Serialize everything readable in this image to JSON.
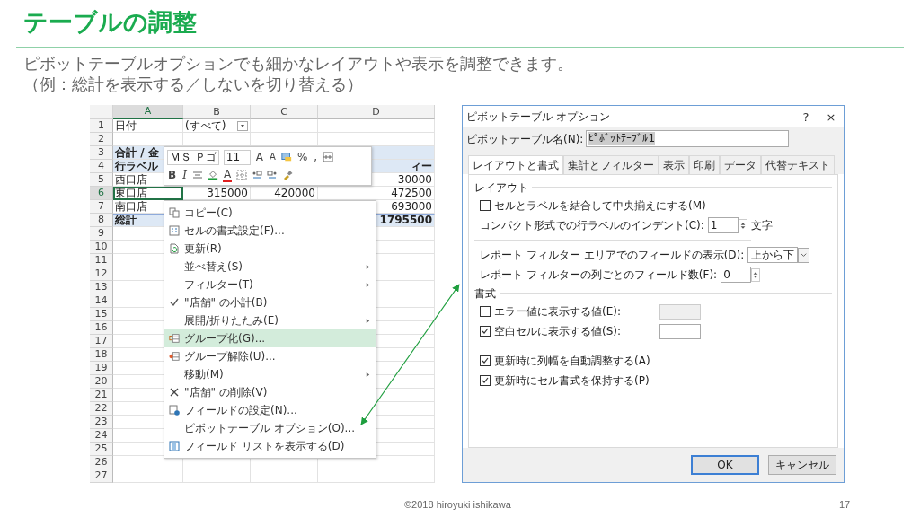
{
  "slide": {
    "title": "テーブルの調整",
    "lines": [
      "ピボットテーブルオプションでも細かなレイアウトや表示を調整できます。",
      "（例：総計を表示する／しないを切り替える）"
    ]
  },
  "sheet": {
    "columns": [
      {
        "label": "A",
        "selected": true
      },
      {
        "label": "B",
        "selected": false
      },
      {
        "label": "C",
        "selected": false
      },
      {
        "label": "D",
        "selected": false
      }
    ],
    "rows": [
      {
        "number": "1",
        "kind": "filter",
        "selected": false,
        "cells": {
          "A": "日付",
          "B": "(すべて)"
        }
      },
      {
        "number": "2",
        "kind": "empty",
        "selected": false,
        "cells": {}
      },
      {
        "number": "3",
        "kind": "header",
        "selected": false,
        "cells": {
          "A": "合計 / 金"
        }
      },
      {
        "number": "4",
        "kind": "header",
        "selected": false,
        "cells": {
          "A": "行ラベル",
          "D": "ィー"
        }
      },
      {
        "number": "5",
        "kind": "data",
        "selected": false,
        "cells": {
          "A": "西口店",
          "D": "30000"
        }
      },
      {
        "number": "6",
        "kind": "data",
        "selected": true,
        "cells": {
          "A": "東口店",
          "B": "315000",
          "C": "420000",
          "D": "472500"
        }
      },
      {
        "number": "7",
        "kind": "data",
        "selected": false,
        "cells": {
          "A": "南口店",
          "D": "693000"
        }
      },
      {
        "number": "8",
        "kind": "total",
        "selected": false,
        "cells": {
          "A": "総計",
          "D": "1795500"
        }
      },
      {
        "number": "9",
        "kind": "empty",
        "selected": false,
        "cells": {}
      },
      {
        "number": "10",
        "kind": "empty",
        "selected": false,
        "cells": {}
      },
      {
        "number": "11",
        "kind": "empty",
        "selected": false,
        "cells": {}
      },
      {
        "number": "12",
        "kind": "empty",
        "selected": false,
        "cells": {}
      },
      {
        "number": "13",
        "kind": "empty",
        "selected": false,
        "cells": {}
      },
      {
        "number": "14",
        "kind": "empty",
        "selected": false,
        "cells": {}
      },
      {
        "number": "15",
        "kind": "empty",
        "selected": false,
        "cells": {}
      },
      {
        "number": "16",
        "kind": "empty",
        "selected": false,
        "cells": {}
      },
      {
        "number": "17",
        "kind": "empty",
        "selected": false,
        "cells": {}
      },
      {
        "number": "18",
        "kind": "empty",
        "selected": false,
        "cells": {}
      },
      {
        "number": "19",
        "kind": "empty",
        "selected": false,
        "cells": {}
      },
      {
        "number": "20",
        "kind": "empty",
        "selected": false,
        "cells": {}
      },
      {
        "number": "21",
        "kind": "empty",
        "selected": false,
        "cells": {}
      },
      {
        "number": "22",
        "kind": "empty",
        "selected": false,
        "cells": {}
      },
      {
        "number": "23",
        "kind": "empty",
        "selected": false,
        "cells": {}
      },
      {
        "number": "24",
        "kind": "empty",
        "selected": false,
        "cells": {}
      },
      {
        "number": "25",
        "kind": "empty",
        "selected": false,
        "cells": {}
      },
      {
        "number": "26",
        "kind": "empty",
        "selected": false,
        "cells": {}
      },
      {
        "number": "27",
        "kind": "empty",
        "selected": false,
        "cells": {}
      }
    ]
  },
  "mini_toolbar": {
    "font_name": "ＭＳ Ｐゴ",
    "font_size": "11",
    "row_1": [
      {
        "kind": "grow",
        "label": "A"
      },
      {
        "kind": "shrink",
        "label": "A"
      },
      {
        "kind": "format"
      },
      {
        "kind": "text",
        "label": "%"
      },
      {
        "kind": "text",
        "label": ","
      },
      {
        "kind": "wrap"
      }
    ],
    "row_2": [
      {
        "kind": "bold",
        "label": "B"
      },
      {
        "kind": "italic",
        "label": "I"
      },
      {
        "kind": "align"
      },
      {
        "kind": "fill"
      },
      {
        "kind": "font_color",
        "label": "A"
      },
      {
        "kind": "border"
      },
      {
        "kind": "increase_decimal"
      },
      {
        "kind": "decrease_decimal"
      },
      {
        "kind": "brush"
      }
    ]
  },
  "context_menu": {
    "items": [
      {
        "label": "コピー(C)",
        "kind": "copy",
        "submenu": false,
        "checked": false,
        "selected": false
      },
      {
        "label": "セルの書式設定(F)...",
        "kind": "format",
        "submenu": false,
        "checked": false,
        "selected": false
      },
      {
        "label": "更新(R)",
        "kind": "refresh",
        "submenu": false,
        "checked": false,
        "selected": false
      },
      {
        "label": "並べ替え(S)",
        "kind": "plain",
        "submenu": true,
        "checked": false,
        "selected": false
      },
      {
        "label": "フィルター(T)",
        "kind": "plain",
        "submenu": true,
        "checked": false,
        "selected": false
      },
      {
        "label": "\"店舗\" の小計(B)",
        "kind": "plain",
        "submenu": false,
        "checked": true,
        "selected": false
      },
      {
        "label": "展開/折りたたみ(E)",
        "kind": "plain",
        "submenu": true,
        "checked": false,
        "selected": false
      },
      {
        "label": "グループ化(G)...",
        "kind": "group",
        "submenu": false,
        "checked": false,
        "selected": true
      },
      {
        "label": "グループ解除(U)...",
        "kind": "ungroup",
        "submenu": false,
        "checked": false,
        "selected": false
      },
      {
        "label": "移動(M)",
        "kind": "plain",
        "submenu": true,
        "checked": false,
        "selected": false
      },
      {
        "label": "\"店舗\" の削除(V)",
        "kind": "delete",
        "submenu": false,
        "checked": false,
        "selected": false
      },
      {
        "label": "フィールドの設定(N)...",
        "kind": "settings",
        "submenu": false,
        "checked": false,
        "selected": false
      },
      {
        "label": "ピボットテーブル オプション(O)...",
        "kind": "plain",
        "submenu": false,
        "checked": false,
        "selected": false
      },
      {
        "label": "フィールド リストを表示する(D)",
        "kind": "list",
        "submenu": false,
        "checked": false,
        "selected": false
      }
    ]
  },
  "dialog": {
    "title": "ピボットテーブル オプション",
    "help": "?",
    "close": "×",
    "name_label": "ピボットテーブル名(N):",
    "name_value": "ﾋﾟﾎﾞｯﾄﾃｰﾌﾞﾙ1",
    "tabs": [
      {
        "label": "レイアウトと書式",
        "selected": true
      },
      {
        "label": "集計とフィルター",
        "selected": false
      },
      {
        "label": "表示",
        "selected": false
      },
      {
        "label": "印刷",
        "selected": false
      },
      {
        "label": "データ",
        "selected": false
      },
      {
        "label": "代替テキスト",
        "selected": false
      }
    ],
    "items": [
      {
        "kind": "heading",
        "label": "レイアウト"
      },
      {
        "kind": "checkbox",
        "label": "セルとラベルを結合して中央揃えにする(M)",
        "checked": false
      },
      {
        "kind": "spinner",
        "label": "コンパクト形式での行ラベルのインデント(C):",
        "value": "1",
        "suffix": "文字"
      },
      {
        "kind": "divider"
      },
      {
        "kind": "select",
        "label": "レポート フィルター エリアでのフィールドの表示(D):",
        "value": "上から下"
      },
      {
        "kind": "spinner",
        "label": "レポート フィルターの列ごとのフィールド数(F):",
        "value": "0"
      },
      {
        "kind": "heading",
        "label": "書式"
      },
      {
        "kind": "checkbox_field",
        "label": "エラー値に表示する値(E):",
        "checked": false,
        "disabled": true
      },
      {
        "kind": "checkbox_field",
        "label": "空白セルに表示する値(S):",
        "checked": true,
        "disabled": false
      },
      {
        "kind": "divider"
      },
      {
        "kind": "checkbox",
        "label": "更新時に列幅を自動調整する(A)",
        "checked": true
      },
      {
        "kind": "checkbox",
        "label": "更新時にセル書式を保持する(P)",
        "checked": true
      }
    ],
    "buttons": [
      {
        "label": "OK",
        "default": true
      },
      {
        "label": "キャンセル",
        "default": false
      }
    ]
  },
  "footer": {
    "copyright": "©2018 hiroyuki ishikawa",
    "page": "17"
  }
}
